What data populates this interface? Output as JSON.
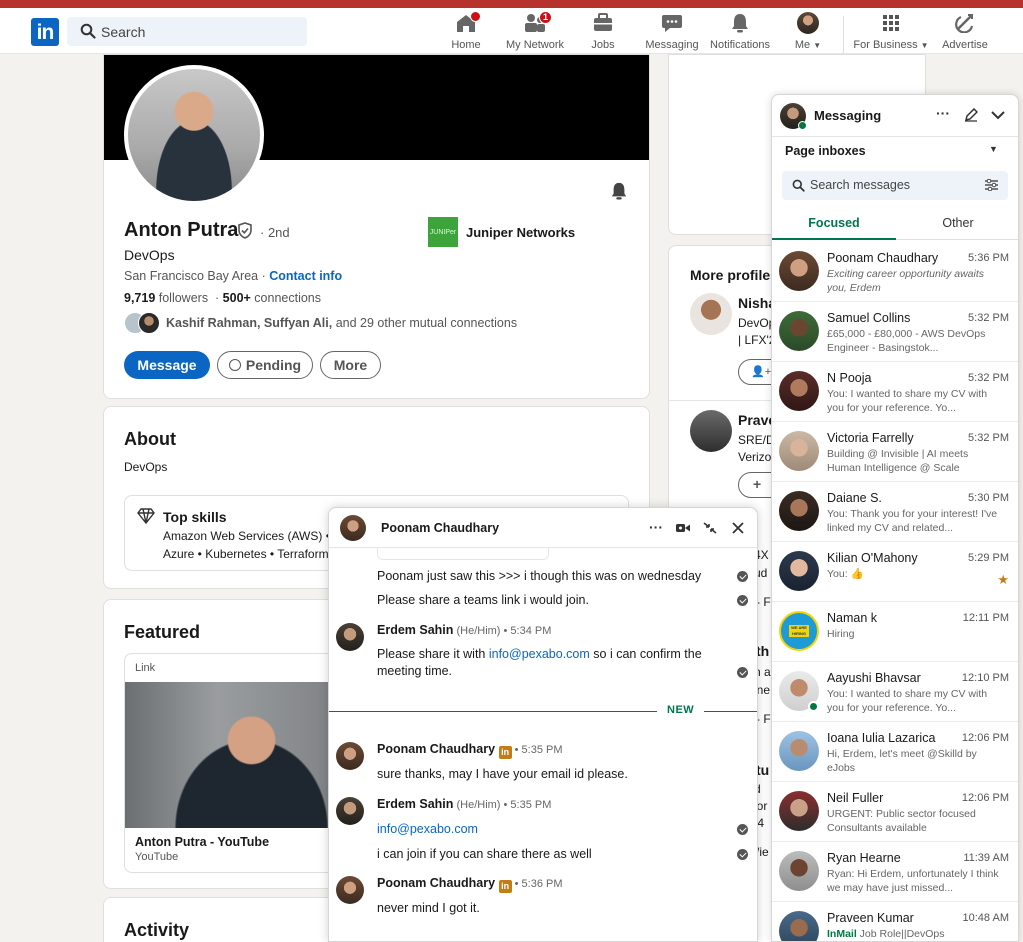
{
  "nav": {
    "search_placeholder": "Search",
    "items": [
      {
        "label": "Home",
        "badge": "",
        "icon": "home-icon"
      },
      {
        "label": "My Network",
        "badge": "1",
        "icon": "network-icon"
      },
      {
        "label": "Jobs",
        "badge": "",
        "icon": "jobs-icon"
      },
      {
        "label": "Messaging",
        "badge": "",
        "icon": "messaging-icon"
      },
      {
        "label": "Notifications",
        "badge": "",
        "icon": "bell-icon"
      },
      {
        "label": "Me",
        "badge": "",
        "icon": "me-avatar"
      },
      {
        "label": "For Business",
        "badge": "",
        "icon": "grid-icon"
      },
      {
        "label": "Advertise",
        "badge": "",
        "icon": "advertise-icon"
      }
    ]
  },
  "profile": {
    "name": "Anton Putra",
    "degree": "· 2nd",
    "headline": "DevOps",
    "location": "San Francisco Bay Area · ",
    "contact_info": "Contact info",
    "followers_count": "9,719",
    "followers_label": " followers",
    "connections_count": "500+",
    "connections_label": " connections",
    "mutual_names": "Kashif Rahman, Suffyan Ali,",
    "mutual_rest": " and 29 other mutual connections",
    "company": "Juniper Networks",
    "company_logo_text": "JUNIPer",
    "btn_message": "Message",
    "btn_pending": "Pending",
    "btn_more": "More"
  },
  "about": {
    "title": "About",
    "text": "DevOps",
    "top_skills_title": "Top skills",
    "skills_line1": "Amazon Web Services (AWS) •",
    "skills_line2": "Azure • Kubernetes • Terraform"
  },
  "featured": {
    "title": "Featured",
    "link_label": "Link",
    "item_title": "Anton Putra - YouTube",
    "item_source": "YouTube"
  },
  "activity": {
    "title": "Activity"
  },
  "right": {
    "more_profiles": "More profiles",
    "p1_name": "Nisha",
    "p1_l1": "DevOp",
    "p1_l2": "| LFX'2",
    "p2_name": "Prave",
    "p2_l1": "SRE/D",
    "p2_l2": "Verizo",
    "partials": [
      "mi",
      "4X",
      "ud",
      "- F",
      "th",
      "n a",
      "ine",
      "- F",
      "tu",
      "d",
      "ior",
      "t4",
      "/ie"
    ]
  },
  "messaging": {
    "title": "Messaging",
    "page_inboxes": "Page inboxes",
    "search_placeholder": "Search messages",
    "tab_focused": "Focused",
    "tab_other": "Other",
    "conversations": [
      {
        "name": "Poonam Chaudhary",
        "time": "5:36 PM",
        "preview": "Exciting career opportunity awaits you, Erdem",
        "italic": true
      },
      {
        "name": "Samuel Collins",
        "time": "5:32 PM",
        "preview": "£65,000 - £80,000 - AWS DevOps Engineer - Basingstok..."
      },
      {
        "name": "N Pooja",
        "time": "5:32 PM",
        "preview": "You: I wanted to share my CV with you for your reference. Yo..."
      },
      {
        "name": "Victoria Farrelly",
        "time": "5:32 PM",
        "preview": "Building @ Invisible | AI meets Human Intelligence @ Scale"
      },
      {
        "name": "Daiane S.",
        "time": "5:30 PM",
        "preview": "You: Thank you for your interest! I've linked my CV and related..."
      },
      {
        "name": "Kilian O'Mahony",
        "time": "5:29 PM",
        "preview": "You: 👍"
      },
      {
        "name": "Naman k",
        "time": "12:11 PM",
        "preview": "Hiring"
      },
      {
        "name": "Aayushi Bhavsar",
        "time": "12:10 PM",
        "preview": "You: I wanted to share my CV with you for your reference. Yo..."
      },
      {
        "name": "Ioana Iulia Lazarica",
        "time": "12:06 PM",
        "preview": "Hi, Erdem, let's meet @Skilld by eJobs"
      },
      {
        "name": "Neil Fuller",
        "time": "12:06 PM",
        "preview": "URGENT: Public sector focused Consultants available"
      },
      {
        "name": "Ryan Hearne",
        "time": "11:39 AM",
        "preview": "Ryan: Hi Erdem, unfortunately I think we may have just missed..."
      },
      {
        "name": "Praveen Kumar",
        "time": "10:48 AM",
        "preview_tag": "InMail",
        "preview": " Job Role||DevOps"
      }
    ]
  },
  "chat": {
    "name": "Poonam Chaudhary",
    "msg1": "Poonam just saw this >>> i though this was on wednesday",
    "msg2": "Please share a teams link i would join.",
    "erdem1_name": "Erdem Sahin",
    "erdem1_meta": " (He/Him) • 5:34 PM",
    "erdem1_pre": "Please share it with ",
    "erdem1_email": "info@pexabo.com",
    "erdem1_post": " so i can confirm the meeting time.",
    "new_label": "NEW",
    "poonam2_name": "Poonam Chaudhary",
    "poonam2_meta": " • 5:35 PM",
    "poonam2_text": "sure thanks, may I have your email id please.",
    "erdem2_name": "Erdem Sahin",
    "erdem2_meta": " (He/Him) • 5:35 PM",
    "erdem2_email": "info@pexabo.com",
    "erdem2_text": "i can join if you can share there as well",
    "poonam3_name": "Poonam Chaudhary",
    "poonam3_meta": " • 5:36 PM",
    "poonam3_text": "never mind I got it."
  }
}
